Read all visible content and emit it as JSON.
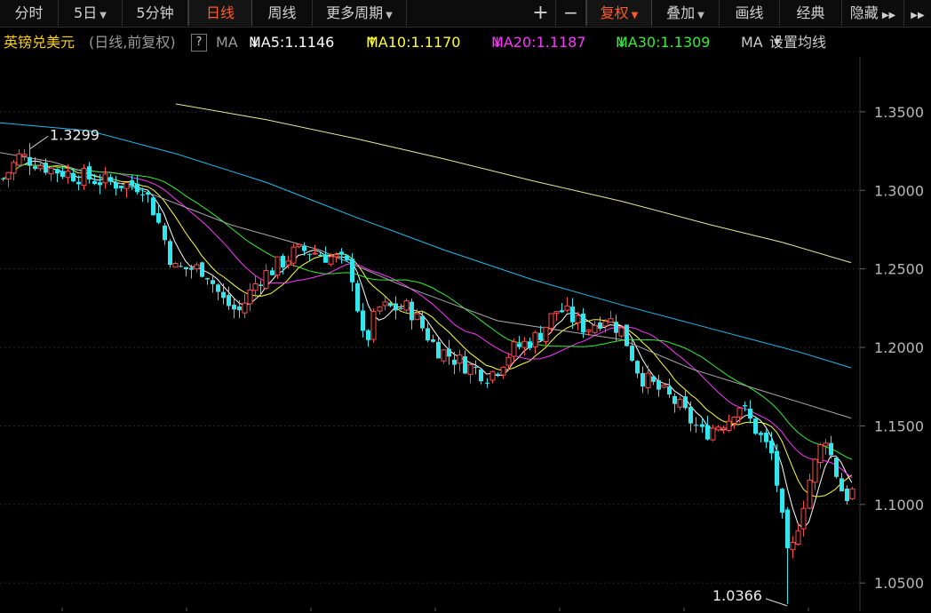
{
  "toolbar": {
    "tabs": [
      {
        "label": "分时",
        "caret": false,
        "active": false
      },
      {
        "label": "5日",
        "caret": true,
        "active": false
      },
      {
        "label": "5分钟",
        "caret": false,
        "active": false
      },
      {
        "label": "日线",
        "caret": false,
        "active": true
      },
      {
        "label": "周线",
        "caret": false,
        "active": false
      },
      {
        "label": "更多周期",
        "caret": true,
        "active": false
      }
    ],
    "plus": "+",
    "minus": "−",
    "fuquan": "复权",
    "diejia": "叠加",
    "huaxian": "画线",
    "jingdian": "经典",
    "yincang": "隐藏"
  },
  "info": {
    "instrument": "英镑兑美元",
    "mode": "(日线,前复权)",
    "help": "?",
    "ma_label": "MA",
    "ma5": "MA5:1.1146",
    "ma10": "MA10:1.1170",
    "ma20": "MA20:1.1187",
    "ma30": "MA30:1.1309",
    "ma_cut": "MA",
    "settings": "设置均线",
    "ma5_arrow": "↓",
    "ma10_arrow": "↑",
    "ma20_arrow": "↓",
    "ma30_arrow": "↓",
    "colors": {
      "ma5": "#ffffff",
      "ma10": "#ffff33",
      "ma20": "#ff33ff",
      "ma30": "#33ee33",
      "up": "#ff4a4a",
      "down": "#33e6ee",
      "ma60": "#aaaaaa",
      "ma120": "#22bbee",
      "ma250": "#e8e89a"
    }
  },
  "chart_data": {
    "type": "candlestick",
    "y_ticks": [
      "1.3500",
      "1.3000",
      "1.2500",
      "1.2000",
      "1.1500",
      "1.1000",
      "1.0500"
    ],
    "ylim": [
      1.032,
      1.385
    ],
    "annotations": {
      "high": "1.3299",
      "low": "1.0366"
    },
    "high_value": 1.3299,
    "low_value": 1.0366,
    "grid": true
  }
}
